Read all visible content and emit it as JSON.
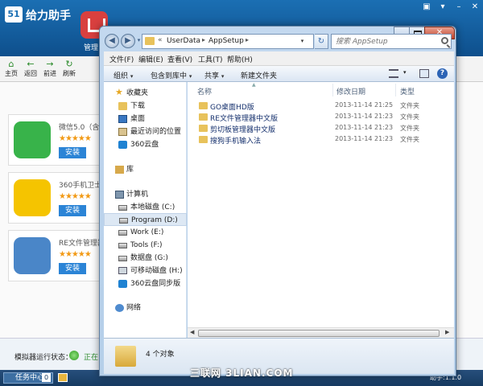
{
  "app": {
    "title": "给力助手",
    "home_label": "管理",
    "toolbar": {
      "home": "主页",
      "back": "返回",
      "forward": "前进",
      "refresh": "刷新"
    },
    "apps": [
      {
        "name": "微信5.0（含",
        "install": "安装",
        "stars": "★★★★★",
        "color": "#38b34a"
      },
      {
        "name": "360手机卫士",
        "install": "安装",
        "stars": "★★★★★",
        "color": "#f5c400"
      },
      {
        "name": "RE文件管理器",
        "install": "安装",
        "stars": "★★★★★",
        "color": "#4a86c8"
      }
    ],
    "emulator_status_label": "模拟器运行状态：",
    "emulator_status_value": "正在",
    "taskbar": {
      "task_center": "任务中心",
      "count": "0",
      "helper_version": "助手:1.1.0"
    },
    "watermark": "三联网 3LIAN.COM"
  },
  "explorer": {
    "address": {
      "separator": "«",
      "crumbs": [
        "UserData",
        "AppSetup"
      ]
    },
    "search_placeholder": "搜索 AppSetup",
    "menu": [
      "文件(F)",
      "编辑(E)",
      "查看(V)",
      "工具(T)",
      "帮助(H)"
    ],
    "commands": {
      "organize": "组织",
      "include_in_library": "包含到库中",
      "share": "共享",
      "new_folder": "新建文件夹"
    },
    "nav": {
      "favorites": "收藏夹",
      "downloads": "下载",
      "desktop": "桌面",
      "recent": "最近访问的位置",
      "cloud": "360云盘",
      "library": "库",
      "computer": "计算机",
      "drives": [
        "本地磁盘 (C:)",
        "Program (D:)",
        "Work (E:)",
        "Tools (F:)",
        "数据盘 (G:)",
        "可移动磁盘 (H:)",
        "360云盘同步版"
      ],
      "network": "网络"
    },
    "columns": {
      "name": "名称",
      "date": "修改日期",
      "type": "类型"
    },
    "files": [
      {
        "name": "GO桌面HD版",
        "date": "2013-11-14 21:25",
        "type": "文件夹"
      },
      {
        "name": "RE文件管理器中文版",
        "date": "2013-11-14 21:23",
        "type": "文件夹"
      },
      {
        "name": "剪切板管理器中文版",
        "date": "2013-11-14 21:23",
        "type": "文件夹"
      },
      {
        "name": "搜狗手机输入法",
        "date": "2013-11-14 21:23",
        "type": "文件夹"
      }
    ],
    "item_count": "4 个对象"
  }
}
